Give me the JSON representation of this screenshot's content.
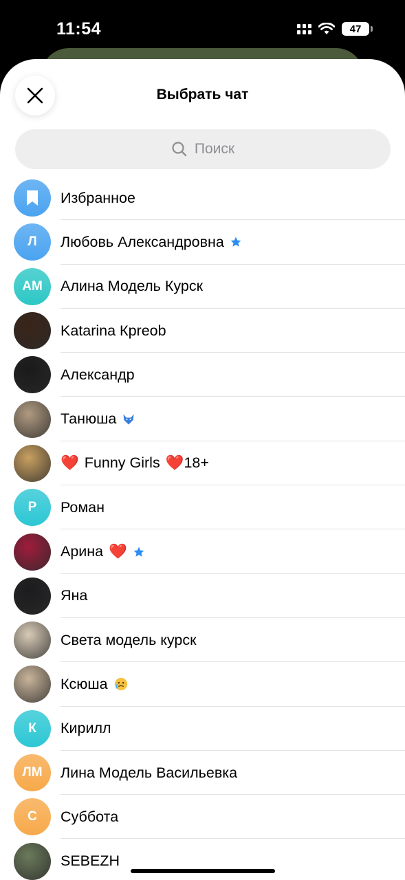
{
  "status_bar": {
    "time": "11:54",
    "battery": "47"
  },
  "sheet": {
    "title": "Выбрать чат",
    "search_placeholder": "Поиск"
  },
  "chats": [
    {
      "name": "Избранное",
      "avatar_type": "icon",
      "avatar_icon": "bookmark-icon",
      "avatar_color": "#4aa3f0"
    },
    {
      "name": "Любовь Александровна",
      "avatar_type": "initials",
      "initials": "Л",
      "avatar_color": "#4aa3f0",
      "badge": "star-icon"
    },
    {
      "name": "Алина Модель Курск",
      "avatar_type": "initials",
      "initials": "АМ",
      "avatar_color": "#2cc7c5"
    },
    {
      "name": "Katarina Кpreob",
      "avatar_type": "photo",
      "avatar_color": "#3a2418"
    },
    {
      "name": "Александр",
      "avatar_type": "photo",
      "avatar_color": "#1a1a1a"
    },
    {
      "name": "Танюша",
      "avatar_type": "photo",
      "avatar_color": "#b09a80",
      "badge": "fox-icon"
    },
    {
      "name": "Funny Girls",
      "prefix_emoji": "❤️",
      "suffix": "❤️18+",
      "avatar_type": "photo",
      "avatar_color": "#c9a060"
    },
    {
      "name": "Роман",
      "avatar_type": "initials",
      "initials": "Р",
      "avatar_color": "#2cc7d4"
    },
    {
      "name": "Арина",
      "suffix": "❤️",
      "avatar_type": "photo",
      "avatar_color": "#a01c3c",
      "badge": "star-icon"
    },
    {
      "name": "Яна",
      "avatar_type": "photo",
      "avatar_color": "#1c1c1e"
    },
    {
      "name": "Света модель курск",
      "avatar_type": "photo",
      "avatar_color": "#d8cbb6"
    },
    {
      "name": "Ксюша",
      "avatar_type": "photo",
      "avatar_color": "#c8b49a",
      "badge": "emoji-tears"
    },
    {
      "name": "Кирилл",
      "avatar_type": "initials",
      "initials": "К",
      "avatar_color": "#2cc7d4"
    },
    {
      "name": "Лина Модель Васильевка",
      "avatar_type": "initials",
      "initials": "ЛМ",
      "avatar_color": "#f7a94a"
    },
    {
      "name": "Суббота",
      "avatar_type": "initials",
      "initials": "С",
      "avatar_color": "#f7a94a"
    },
    {
      "name": "SEBEZH",
      "avatar_type": "photo",
      "avatar_color": "#6a7a5a"
    }
  ],
  "colors": {
    "accent": "#2b8ef0",
    "heart": "#e0243a"
  }
}
